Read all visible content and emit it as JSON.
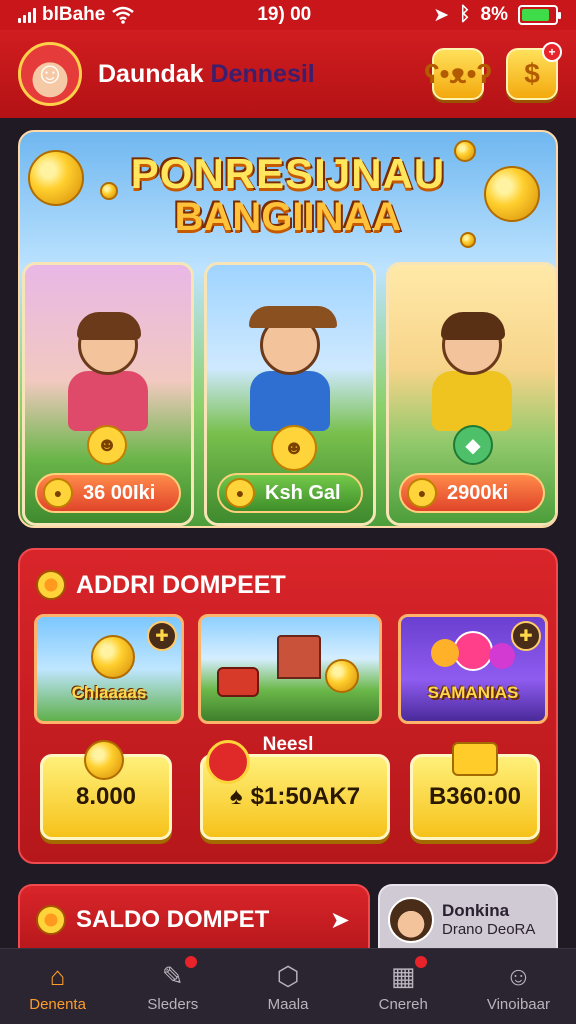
{
  "status": {
    "carrier": "blBahe",
    "time": "19) 00",
    "battery": "8%",
    "battery_level": 0.85
  },
  "header": {
    "name_part1": "Daundak",
    "name_part2": "Dennesil"
  },
  "hero": {
    "title_line1": "PONRESIJNAU",
    "title_line2": "BANGIINAA",
    "cards": [
      {
        "prize": "36 00Iki"
      },
      {
        "prize": "Ksh Gal"
      },
      {
        "prize": "2900ki"
      }
    ]
  },
  "wallet": {
    "title": "ADDRI DOMPEET",
    "games": [
      {
        "label": "Chlaaaas"
      },
      {
        "label": ""
      },
      {
        "label": "SAMANIAS"
      }
    ],
    "mid_label": "Neesl",
    "values": [
      "8.000",
      "$1:50AK7",
      "B360:00"
    ]
  },
  "saldo": {
    "title": "SALDO DOMPET"
  },
  "friend": {
    "name": "Donkina",
    "sub": "Drano DeoRA"
  },
  "tabs": [
    {
      "label": "Denenta"
    },
    {
      "label": "Sleders"
    },
    {
      "label": "Maala"
    },
    {
      "label": "Cnereh"
    },
    {
      "label": "Vinoibaar"
    }
  ]
}
